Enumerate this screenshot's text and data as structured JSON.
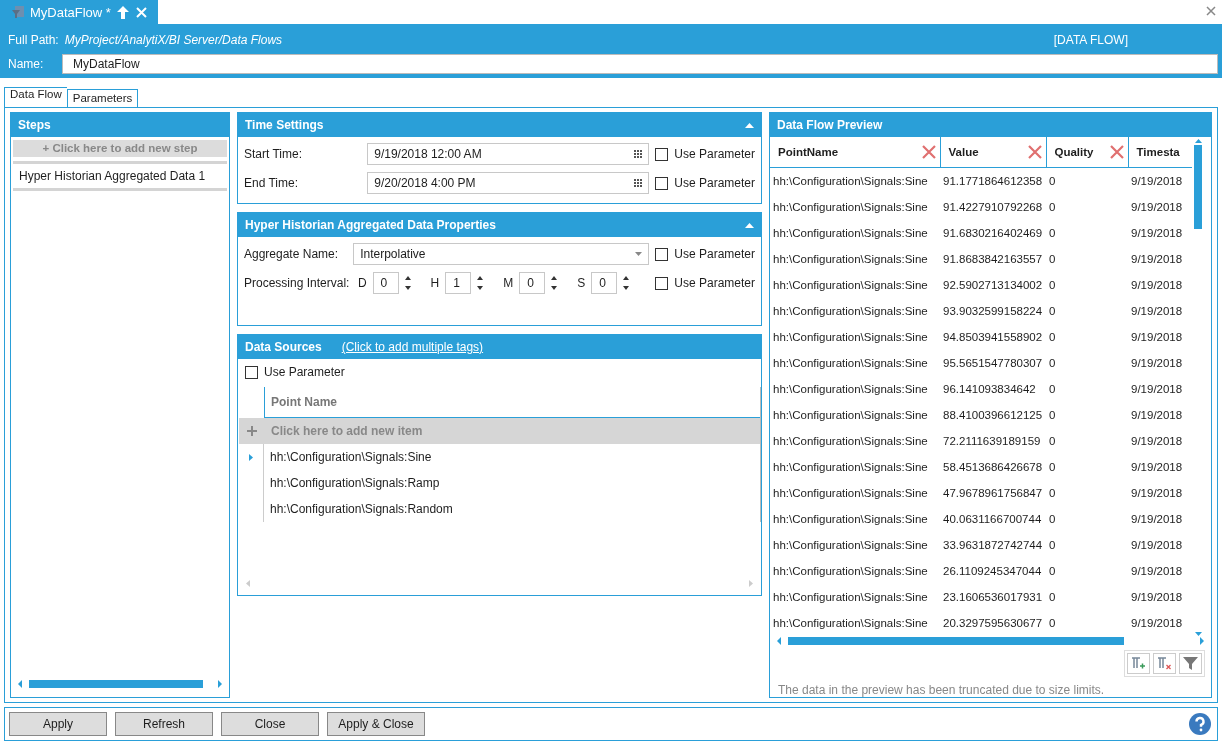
{
  "doc_tab": {
    "title": "MyDataFlow *"
  },
  "header": {
    "full_path_label": "Full Path:",
    "full_path": "MyProject/AnalytiX/BI Server/Data Flows",
    "type_label": "[DATA FLOW]",
    "name_label": "Name:",
    "name_value": "MyDataFlow"
  },
  "tabs": [
    {
      "label": "Data Flow",
      "selected": true
    },
    {
      "label": "Parameters",
      "selected": false
    }
  ],
  "steps": {
    "title": "Steps",
    "add_text": "+  Click here to add new step",
    "items": [
      {
        "label": "Hyper Historian Aggregated Data",
        "count": "1"
      }
    ]
  },
  "time_settings": {
    "title": "Time Settings",
    "rows": [
      {
        "label": "Start Time:",
        "value": "9/19/2018 12:00 AM",
        "use_parameter": "Use Parameter",
        "checked": false
      },
      {
        "label": "End Time:",
        "value": "9/20/2018 4:00 PM",
        "use_parameter": "Use Parameter",
        "checked": false
      }
    ]
  },
  "aggregate": {
    "title": "Hyper Historian Aggregated Data Properties",
    "name_label": "Aggregate Name:",
    "name_value": "Interpolative",
    "name_use_parameter": "Use Parameter",
    "name_checked": false,
    "interval_label": "Processing Interval:",
    "interval_use_parameter": "Use Parameter",
    "interval_checked": false,
    "parts": [
      {
        "unit": "D",
        "value": "0"
      },
      {
        "unit": "H",
        "value": "1"
      },
      {
        "unit": "M",
        "value": "0"
      },
      {
        "unit": "S",
        "value": "0"
      }
    ]
  },
  "data_sources": {
    "title": "Data Sources",
    "link": "(Click to add multiple tags)",
    "use_parameter": "Use Parameter",
    "checked": false,
    "column": "Point Name",
    "add_text": "Click here to add new item",
    "rows": [
      {
        "name": "hh:\\Configuration\\Signals:Sine",
        "current": true
      },
      {
        "name": "hh:\\Configuration\\Signals:Ramp",
        "current": false
      },
      {
        "name": "hh:\\Configuration\\Signals:Random",
        "current": false
      }
    ]
  },
  "preview": {
    "title": "Data Flow Preview",
    "columns": [
      {
        "label": "PointName",
        "clear": true
      },
      {
        "label": "Value",
        "clear": true
      },
      {
        "label": "Quality",
        "clear": true
      },
      {
        "label": "Timesta",
        "clear": false
      }
    ],
    "rows": [
      [
        "hh:\\Configuration\\Signals:Sine",
        "91.1771864612358",
        "0",
        "9/19/2018"
      ],
      [
        "hh:\\Configuration\\Signals:Sine",
        "91.4227910792268",
        "0",
        "9/19/2018"
      ],
      [
        "hh:\\Configuration\\Signals:Sine",
        "91.6830216402469",
        "0",
        "9/19/2018"
      ],
      [
        "hh:\\Configuration\\Signals:Sine",
        "91.8683842163557",
        "0",
        "9/19/2018"
      ],
      [
        "hh:\\Configuration\\Signals:Sine",
        "92.5902713134002",
        "0",
        "9/19/2018"
      ],
      [
        "hh:\\Configuration\\Signals:Sine",
        "93.9032599158224",
        "0",
        "9/19/2018"
      ],
      [
        "hh:\\Configuration\\Signals:Sine",
        "94.8503941558902",
        "0",
        "9/19/2018"
      ],
      [
        "hh:\\Configuration\\Signals:Sine",
        "95.5651547780307",
        "0",
        "9/19/2018"
      ],
      [
        "hh:\\Configuration\\Signals:Sine",
        "96.141093834642",
        "0",
        "9/19/2018"
      ],
      [
        "hh:\\Configuration\\Signals:Sine",
        "88.4100396612125",
        "0",
        "9/19/2018"
      ],
      [
        "hh:\\Configuration\\Signals:Sine",
        "72.2111639189159",
        "0",
        "9/19/2018"
      ],
      [
        "hh:\\Configuration\\Signals:Sine",
        "58.4513686426678",
        "0",
        "9/19/2018"
      ],
      [
        "hh:\\Configuration\\Signals:Sine",
        "47.9678961756847",
        "0",
        "9/19/2018"
      ],
      [
        "hh:\\Configuration\\Signals:Sine",
        "40.0631166700744",
        "0",
        "9/19/2018"
      ],
      [
        "hh:\\Configuration\\Signals:Sine",
        "33.9631872742744",
        "0",
        "9/19/2018"
      ],
      [
        "hh:\\Configuration\\Signals:Sine",
        "26.1109245347044",
        "0",
        "9/19/2018"
      ],
      [
        "hh:\\Configuration\\Signals:Sine",
        "23.1606536017931",
        "0",
        "9/19/2018"
      ],
      [
        "hh:\\Configuration\\Signals:Sine",
        "20.3297595630677",
        "0",
        "9/19/2018"
      ]
    ],
    "note": "The data in the preview has been truncated due to size limits."
  },
  "buttons": [
    "Apply",
    "Refresh",
    "Close",
    "Apply & Close"
  ]
}
